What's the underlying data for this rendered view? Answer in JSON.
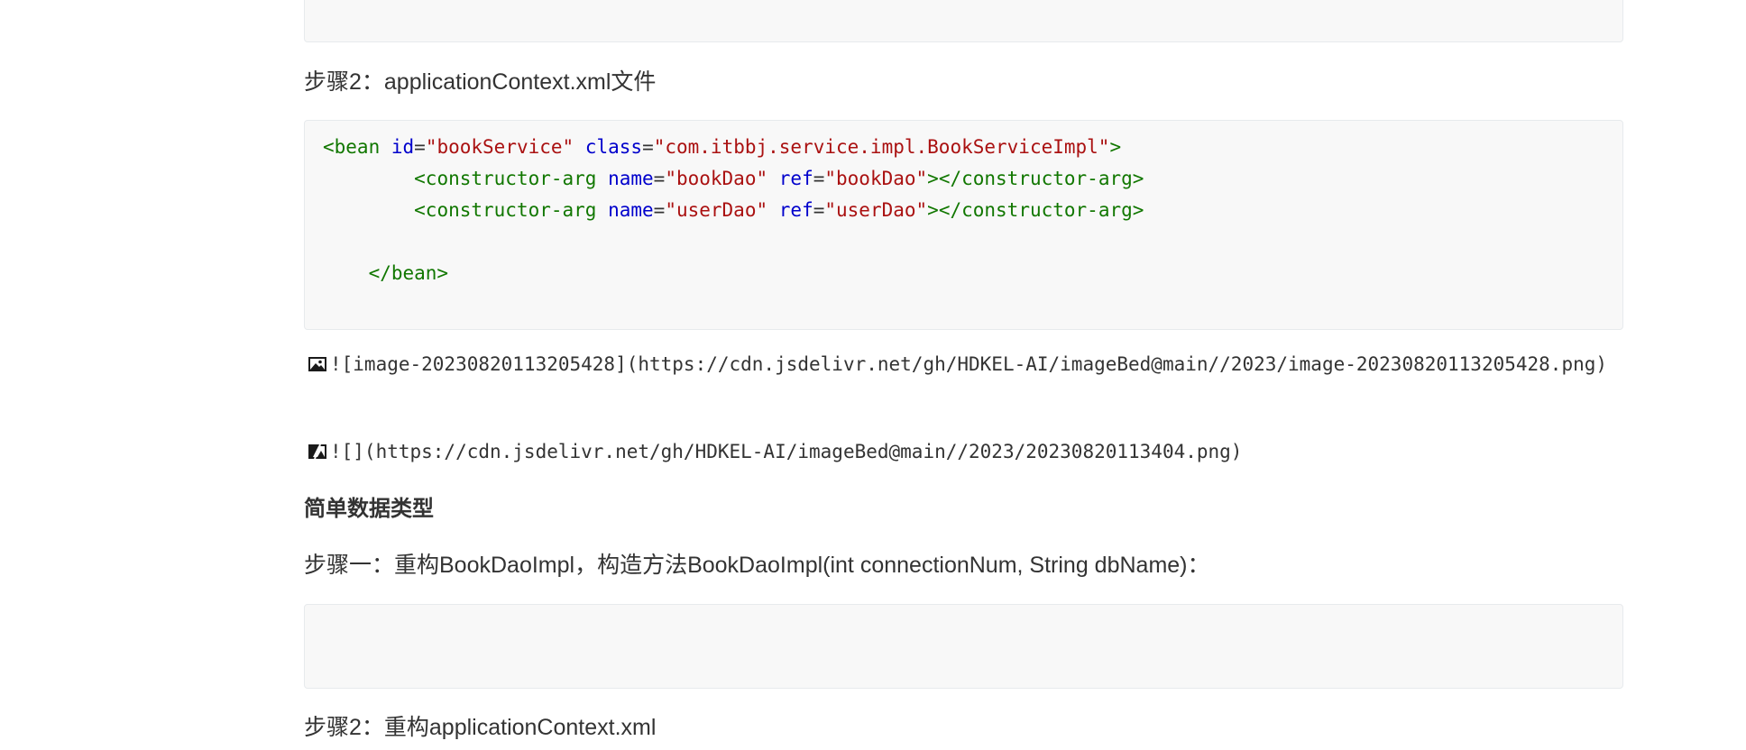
{
  "blocks": {
    "step2_label": "步骤2：applicationContext.xml文件",
    "code_xml": {
      "line1": {
        "open": "<bean ",
        "attr_id": "id",
        "eq1": "=",
        "val_id": "\"bookService\"",
        "sp1": " ",
        "attr_class": "class",
        "eq2": "=",
        "val_class": "\"com.itbbj.service.impl.BookServiceImpl\"",
        "close": ">"
      },
      "line2": {
        "indent": "        ",
        "open": "<constructor-arg ",
        "attr_name": "name",
        "eq1": "=",
        "val_name": "\"bookDao\"",
        "sp": " ",
        "attr_ref": "ref",
        "eq2": "=",
        "val_ref": "\"bookDao\"",
        "close": "></constructor-arg>"
      },
      "line3": {
        "indent": "        ",
        "open": "<constructor-arg ",
        "attr_name": "name",
        "eq1": "=",
        "val_name": "\"userDao\"",
        "sp": " ",
        "attr_ref": "ref",
        "eq2": "=",
        "val_ref": "\"userDao\"",
        "close": "></constructor-arg>"
      },
      "line5": {
        "indent": "    ",
        "close_tag": "</bean>"
      }
    },
    "image_link_1": "![image-20230820113205428](https://cdn.jsdelivr.net/gh/HDKEL-AI/imageBed@main//2023/image-20230820113205428.png)",
    "image_link_2": "![](https://cdn.jsdelivr.net/gh/HDKEL-AI/imageBed@main//2023/20230820113404.png)",
    "heading_simple_types": "简单数据类型",
    "step1_label": "步骤一：重构BookDaoImpl，构造方法BookDaoImpl(int connectionNum, String dbName)：",
    "step2b_label": "步骤2：重构applicationContext.xml"
  },
  "icons": {
    "image_icon": "image-icon",
    "broken_image_icon": "broken-image-icon"
  }
}
